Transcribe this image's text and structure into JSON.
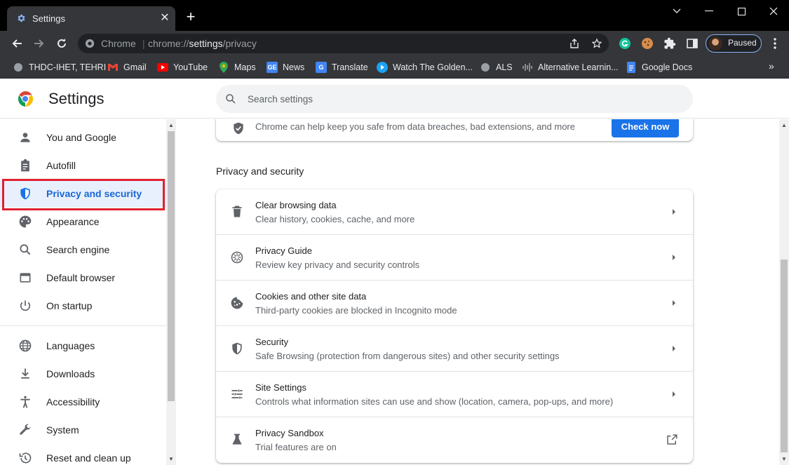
{
  "tab": {
    "title": "Settings",
    "close": "✕",
    "new_tab": "+"
  },
  "toolbar": {
    "omnibox_site": "Chrome",
    "omnibox_sep": "|",
    "url_prefix": "chrome://",
    "url_bold": "settings",
    "url_suffix": "/privacy",
    "profile_label": "Paused"
  },
  "bookmarks": [
    {
      "label": "THDC-IHET, TEHRI",
      "icon": "globe-icon",
      "color": "#9aa0a6"
    },
    {
      "label": "Gmail",
      "icon": "gmail-icon",
      "color": "#ea4335"
    },
    {
      "label": "YouTube",
      "icon": "youtube-icon",
      "color": "#ff0000"
    },
    {
      "label": "Maps",
      "icon": "maps-icon",
      "color": "#34a853"
    },
    {
      "label": "News",
      "icon": "news-icon",
      "color": "#4285f4"
    },
    {
      "label": "Translate",
      "icon": "translate-icon",
      "color": "#4285f4"
    },
    {
      "label": "Watch The Golden...",
      "icon": "play-icon",
      "color": "#1da1f2"
    },
    {
      "label": "ALS",
      "icon": "globe-icon",
      "color": "#9aa0a6"
    },
    {
      "label": "Alternative Learnin...",
      "icon": "audio-icon",
      "color": "#9aa0a6"
    },
    {
      "label": "Google Docs",
      "icon": "docs-icon",
      "color": "#4285f4"
    }
  ],
  "bookmarks_more": "»",
  "header": {
    "title": "Settings",
    "search_placeholder": "Search settings"
  },
  "sidebar": {
    "items": [
      {
        "label": "You and Google",
        "icon": "person-icon"
      },
      {
        "label": "Autofill",
        "icon": "clipboard-icon"
      },
      {
        "label": "Privacy and security",
        "icon": "shield-icon",
        "active": true
      },
      {
        "label": "Appearance",
        "icon": "palette-icon"
      },
      {
        "label": "Search engine",
        "icon": "search-icon"
      },
      {
        "label": "Default browser",
        "icon": "browser-icon"
      },
      {
        "label": "On startup",
        "icon": "power-icon"
      },
      {
        "label": "Languages",
        "icon": "globe-icon"
      },
      {
        "label": "Downloads",
        "icon": "download-icon"
      },
      {
        "label": "Accessibility",
        "icon": "accessibility-icon"
      },
      {
        "label": "System",
        "icon": "wrench-icon"
      },
      {
        "label": "Reset and clean up",
        "icon": "restore-icon"
      }
    ]
  },
  "main": {
    "safety_text": "Chrome can help keep you safe from data breaches, bad extensions, and more",
    "check_now": "Check now",
    "section_title": "Privacy and security",
    "rows": [
      {
        "title": "Clear browsing data",
        "sub": "Clear history, cookies, cache, and more",
        "icon": "trash-icon",
        "action": "arrow"
      },
      {
        "title": "Privacy Guide",
        "sub": "Review key privacy and security controls",
        "icon": "compass-icon",
        "action": "arrow"
      },
      {
        "title": "Cookies and other site data",
        "sub": "Third-party cookies are blocked in Incognito mode",
        "icon": "cookie-icon",
        "action": "arrow"
      },
      {
        "title": "Security",
        "sub": "Safe Browsing (protection from dangerous sites) and other security settings",
        "icon": "shield-icon",
        "action": "arrow"
      },
      {
        "title": "Site Settings",
        "sub": "Controls what information sites can use and show (location, camera, pop-ups, and more)",
        "icon": "tune-icon",
        "action": "arrow"
      },
      {
        "title": "Privacy Sandbox",
        "sub": "Trial features are on",
        "icon": "flask-icon",
        "action": "external"
      }
    ]
  },
  "colors": {
    "accent": "#1a73e8",
    "highlight": "#e0202e",
    "active_bg": "#e8f0fe"
  }
}
